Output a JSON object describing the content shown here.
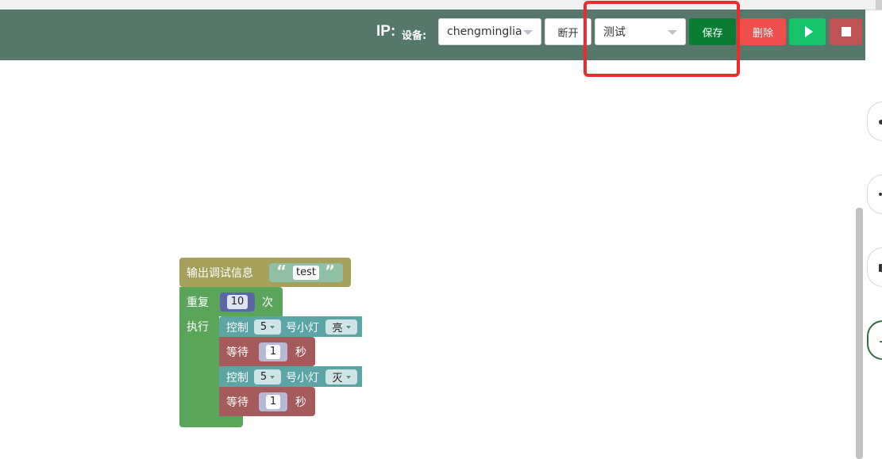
{
  "header": {
    "ip_label": "IP:",
    "device_label": "设备:",
    "device_value": "chengminglia",
    "disconnect_label": "断开",
    "mode_value": "测试",
    "save_label": "保存",
    "delete_label": "删除"
  },
  "blocks": {
    "print_label": "输出调试信息",
    "print_open_quote": "“",
    "print_text": "test",
    "print_close_quote": "”",
    "repeat_label": "重复",
    "repeat_count": "10",
    "repeat_unit": "次",
    "do_label": "执行",
    "steps": [
      {
        "type": "led",
        "prefix": "控制",
        "pin": "5",
        "mid": "号小灯",
        "state": "亮"
      },
      {
        "type": "wait",
        "prefix": "等待",
        "value": "1",
        "unit": "秒"
      },
      {
        "type": "led",
        "prefix": "控制",
        "pin": "5",
        "mid": "号小灯",
        "state": "灭"
      },
      {
        "type": "wait",
        "prefix": "等待",
        "value": "1",
        "unit": "秒"
      }
    ]
  },
  "colors": {
    "header": "#56786a",
    "save": "#0a7d33",
    "delete": "#f04d4d",
    "run": "#17c36a",
    "stop": "#c05454",
    "block_print": "#a5a05b",
    "block_loop": "#5ba55b",
    "block_led": "#5ba5a5",
    "block_wait": "#a55b5b",
    "highlight": "#f02b2b"
  },
  "icons": {
    "run": "play-icon",
    "stop": "stop-icon",
    "dropdown": "caret-down-icon"
  }
}
